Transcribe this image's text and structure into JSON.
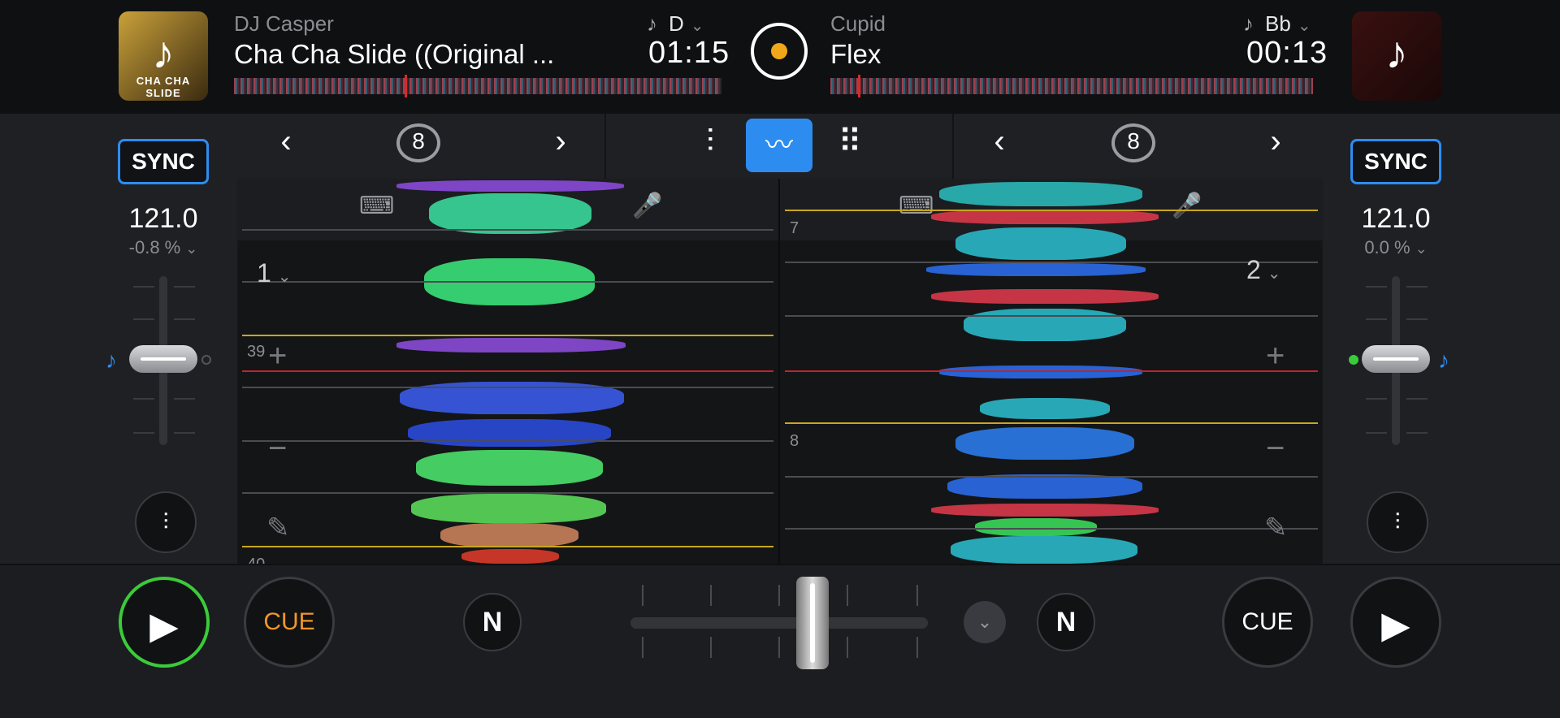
{
  "deck_left": {
    "artist": "DJ Casper",
    "title": "Cha Cha Slide ((Original ...",
    "key": "D",
    "time": "01:15",
    "art_label": "CHA CHA SLIDE",
    "sync_label": "SYNC",
    "bpm": "121.0",
    "pitch": "-0.8 %",
    "deck_number": "1",
    "cue_label": "CUE",
    "cue_color": "#f0962a",
    "play_ring_color": "#3acb3a",
    "loop_size": "8",
    "markers": [
      "39",
      "40"
    ]
  },
  "deck_right": {
    "artist": "Cupid",
    "title": "Flex",
    "key": "Bb",
    "time": "00:13",
    "sync_label": "SYNC",
    "bpm": "121.0",
    "pitch": "0.0 %",
    "deck_number": "2",
    "cue_label": "CUE",
    "cue_color": "#ffffff",
    "loop_size": "8",
    "markers": [
      "7",
      "8"
    ]
  },
  "icons": {
    "note": "♪",
    "chevron_down": "⌄",
    "chevron_left": "‹",
    "chevron_right": "›",
    "play": "▶",
    "plus": "+",
    "minus": "−",
    "pencil": "✎",
    "mixer": "⫶",
    "grid": "⠿",
    "waveform": "〰",
    "n_logo": "N"
  },
  "colors": {
    "accent_blue": "#2d8cf0",
    "center_disc_dot": "#f0a81a",
    "playhead_red": "#d62a2a",
    "beat_yellow": "#c9a620"
  }
}
